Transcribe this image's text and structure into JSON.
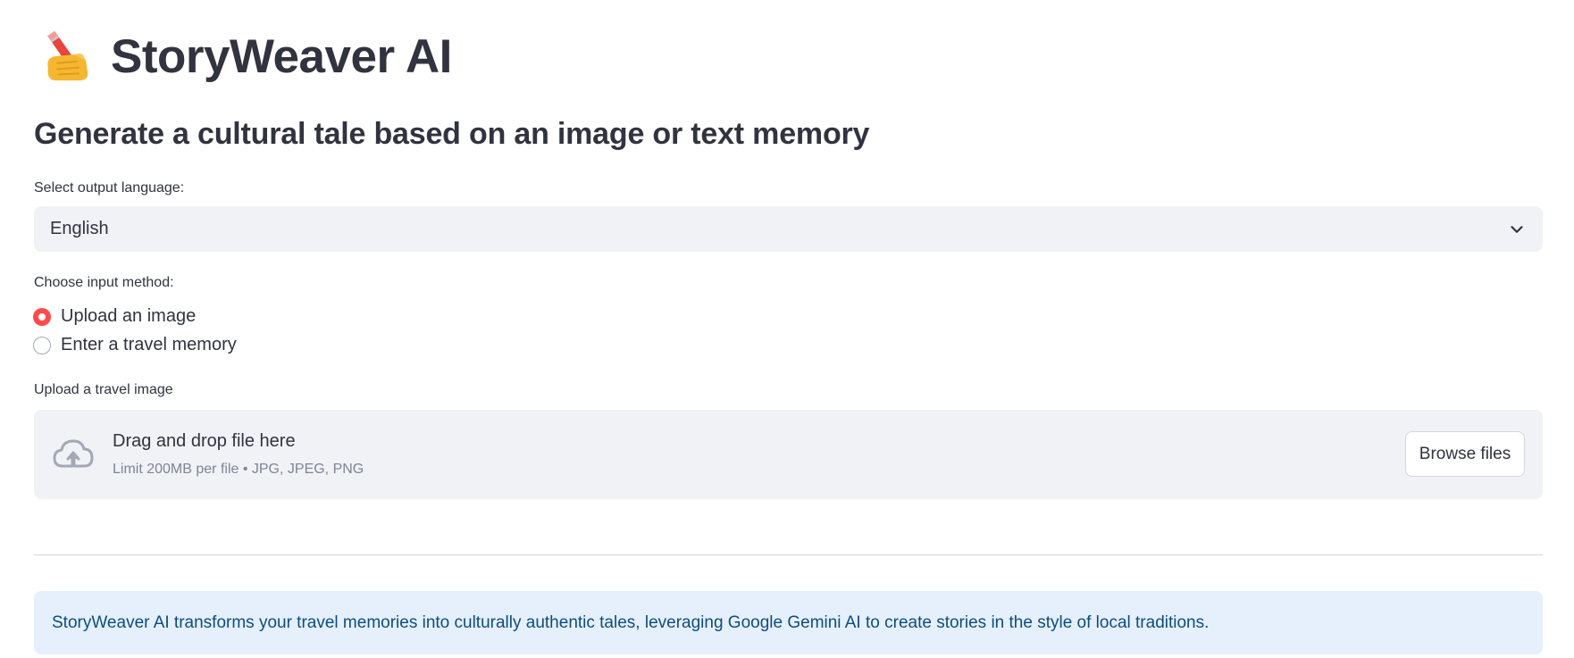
{
  "header": {
    "emoji_icon": "writing-hand-emoji",
    "title": "StoryWeaver AI"
  },
  "subheader": "Generate a cultural tale based on an image or text memory",
  "language_select": {
    "label": "Select output language:",
    "value": "English",
    "icon": "chevron-down-icon"
  },
  "input_method": {
    "label": "Choose input method:",
    "options": [
      {
        "label": "Upload an image",
        "checked": true
      },
      {
        "label": "Enter a travel memory",
        "checked": false
      }
    ]
  },
  "uploader": {
    "label": "Upload a travel image",
    "icon": "cloud-upload-icon",
    "title": "Drag and drop file here",
    "hint": "Limit 200MB per file • JPG, JPEG, PNG",
    "button_label": "Browse files"
  },
  "info": {
    "text": "StoryWeaver AI transforms your travel memories into culturally authentic tales, leveraging Google Gemini AI to create stories in the style of local traditions."
  },
  "colors": {
    "accent": "#ff4b4b",
    "text": "#31333f",
    "widget_bg": "#f0f2f6",
    "info_bg": "#e5f0fc",
    "info_text": "#0e4c7f"
  }
}
